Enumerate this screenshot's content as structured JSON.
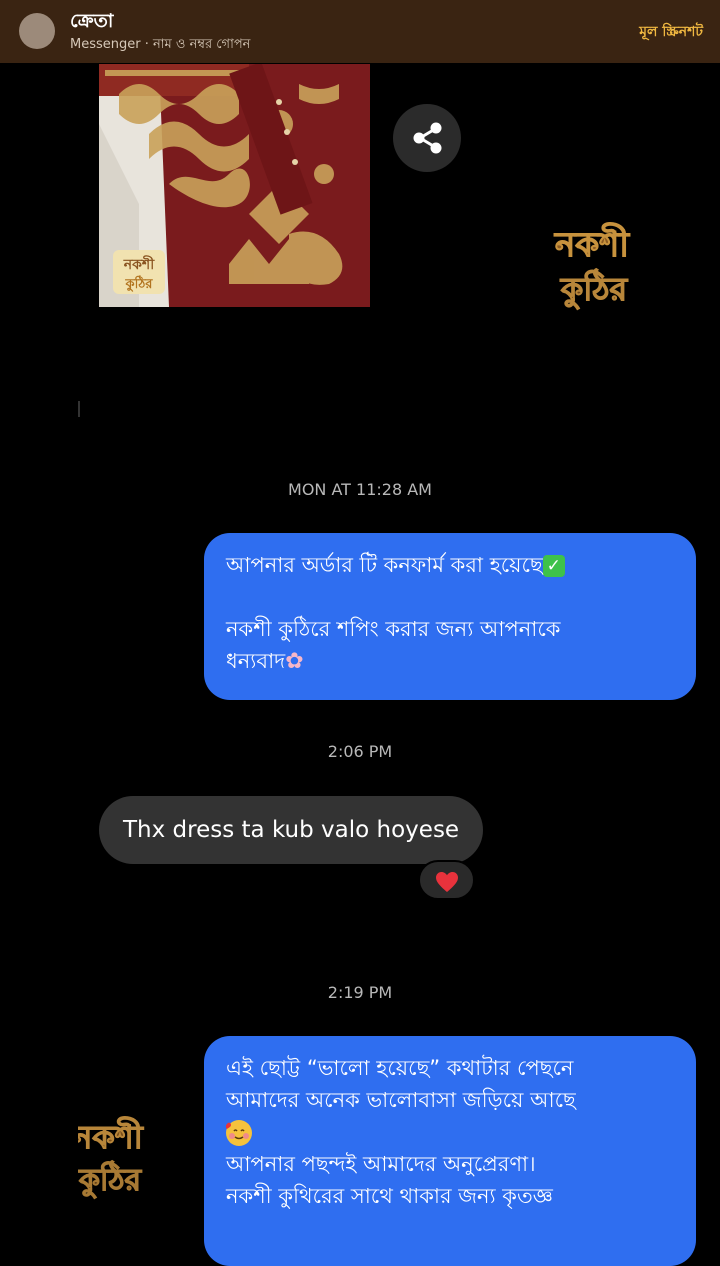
{
  "header": {
    "title": "ক্রেতা",
    "subtitle": "Messenger · নাম ও নম্বর গোপন",
    "original_link": "মূল স্ক্রিনশট"
  },
  "brand": {
    "watermark_line1": "নকশী",
    "watermark_line2": "কুঠির"
  },
  "messages": {
    "ts1": "MON AT 11:28 AM",
    "out1": {
      "line1": "আপনার অর্ডার টি কনফার্ম করা হয়েছে",
      "line2": "নকশী কুঠিরে শপিং করার জন্য আপনাকে",
      "line3": "ধন্যবাদ"
    },
    "ts2": "2:06 PM",
    "in1": "Thx dress ta kub valo hoyese",
    "reaction": "❤",
    "ts3": "2:19 PM",
    "out2": {
      "line1": "এই ছোট্ট “ভালো হয়েছে” কথাটার পেছনে",
      "line2": "আমাদের অনেক ভালোবাসা জড়িয়ে আছে",
      "line3": "আপনার পছন্দই আমাদের অনুপ্রেরণা।",
      "line4": "নকশী কুথিরের সাথে থাকার জন্য কৃতজ্ঞ"
    }
  },
  "colors": {
    "header_bg": "#3a2412",
    "accent_gold": "#f0b841",
    "outgoing_bubble": "#2f6ef0",
    "incoming_bubble": "#333333"
  },
  "icons": {
    "share": "share-icon",
    "check": "check-mark-emoji",
    "flower": "cherry-blossom-emoji",
    "face": "smiling-face-with-hearts-emoji",
    "heart": "red-heart-emoji"
  }
}
